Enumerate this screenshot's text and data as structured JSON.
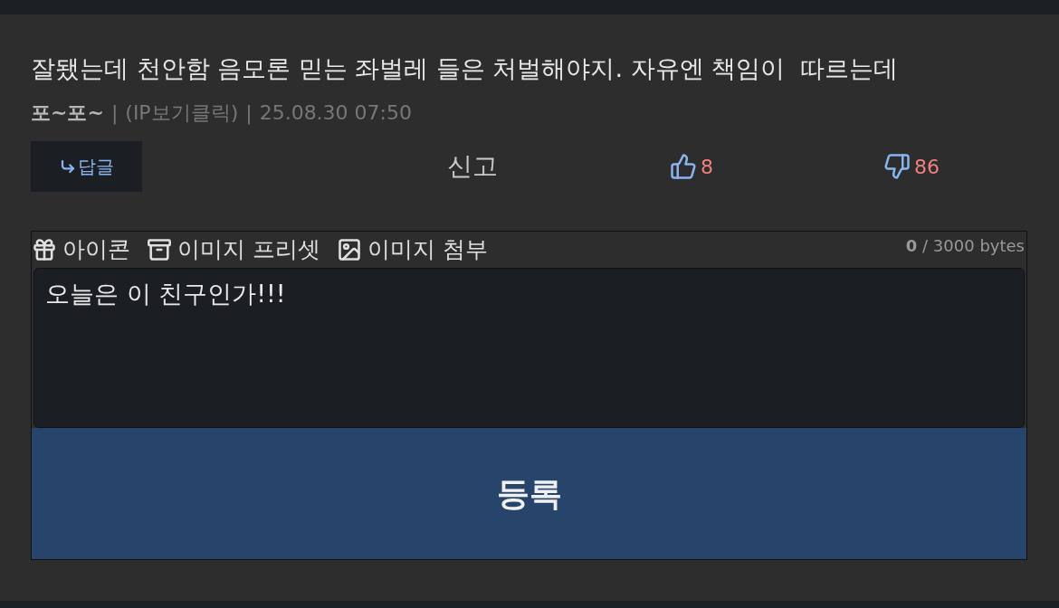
{
  "comment": {
    "text": "잘됐는데 천안함 음모론 믿는 좌벌레 들은 처벌해야지. 자유엔 책임이  따르는데",
    "author": "포~포~",
    "ip": "(IP보기클릭)",
    "timestamp": "25.08.30 07:50",
    "separators": [
      "|",
      "|"
    ]
  },
  "actions": {
    "reply": "답글",
    "report": "신고",
    "likes": "8",
    "dislikes": "86"
  },
  "editor": {
    "tools": [
      {
        "kind": "gift",
        "label": "아이콘"
      },
      {
        "kind": "archive",
        "label": "이미지 프리셋"
      },
      {
        "kind": "image",
        "label": "이미지 첨부"
      }
    ],
    "counter": "**0** / 3000 bytes",
    "value": "오늘은 이 친구인가!!!",
    "submit": "등록"
  }
}
